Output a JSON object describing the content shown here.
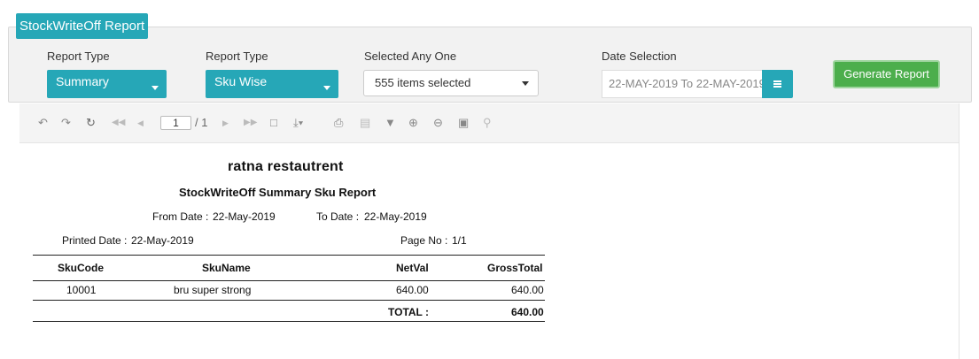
{
  "page_title": "StockWriteOff Report",
  "filters": {
    "report_type_1": {
      "label": "Report Type",
      "value": "Summary"
    },
    "report_type_2": {
      "label": "Report Type",
      "value": "Sku Wise"
    },
    "selected_any_one": {
      "label": "Selected Any One",
      "value": "555 items selected"
    },
    "date_selection": {
      "label": "Date Selection",
      "value": "22-MAY-2019 To 22-MAY-2019"
    },
    "generate_label": "Generate Report"
  },
  "toolbar": {
    "icons": [
      "undo-icon",
      "redo-icon",
      "refresh-icon",
      "first-page-icon",
      "prev-page-icon",
      "next-page-icon",
      "last-page-icon",
      "new-document-icon",
      "export-icon",
      "print-icon",
      "save-icon",
      "filter-icon",
      "zoom-in-icon",
      "zoom-out-icon",
      "fit-icon",
      "search-icon"
    ],
    "current_page": "1",
    "total_pages": "/ 1"
  },
  "report": {
    "company": "ratna  restautrent",
    "title": "StockWriteOff Summary Sku Report",
    "from_date_label": "From Date :",
    "from_date": "22-May-2019",
    "to_date_label": "To Date :",
    "to_date": "22-May-2019",
    "printed_date_label": "Printed Date :",
    "printed_date": "22-May-2019",
    "page_no_label": "Page No :",
    "page_no": "1/1",
    "columns": [
      "SkuCode",
      "SkuName",
      "NetVal",
      "GrossTotal"
    ],
    "rows": [
      {
        "sku_code": "10001",
        "sku_name": "bru super strong",
        "net_val": "640.00",
        "gross_total": "640.00"
      }
    ],
    "total_label": "TOTAL :",
    "total_gross": "640.00"
  },
  "colors": {
    "accent": "#26a7b7",
    "generate": "#4cae4c"
  }
}
